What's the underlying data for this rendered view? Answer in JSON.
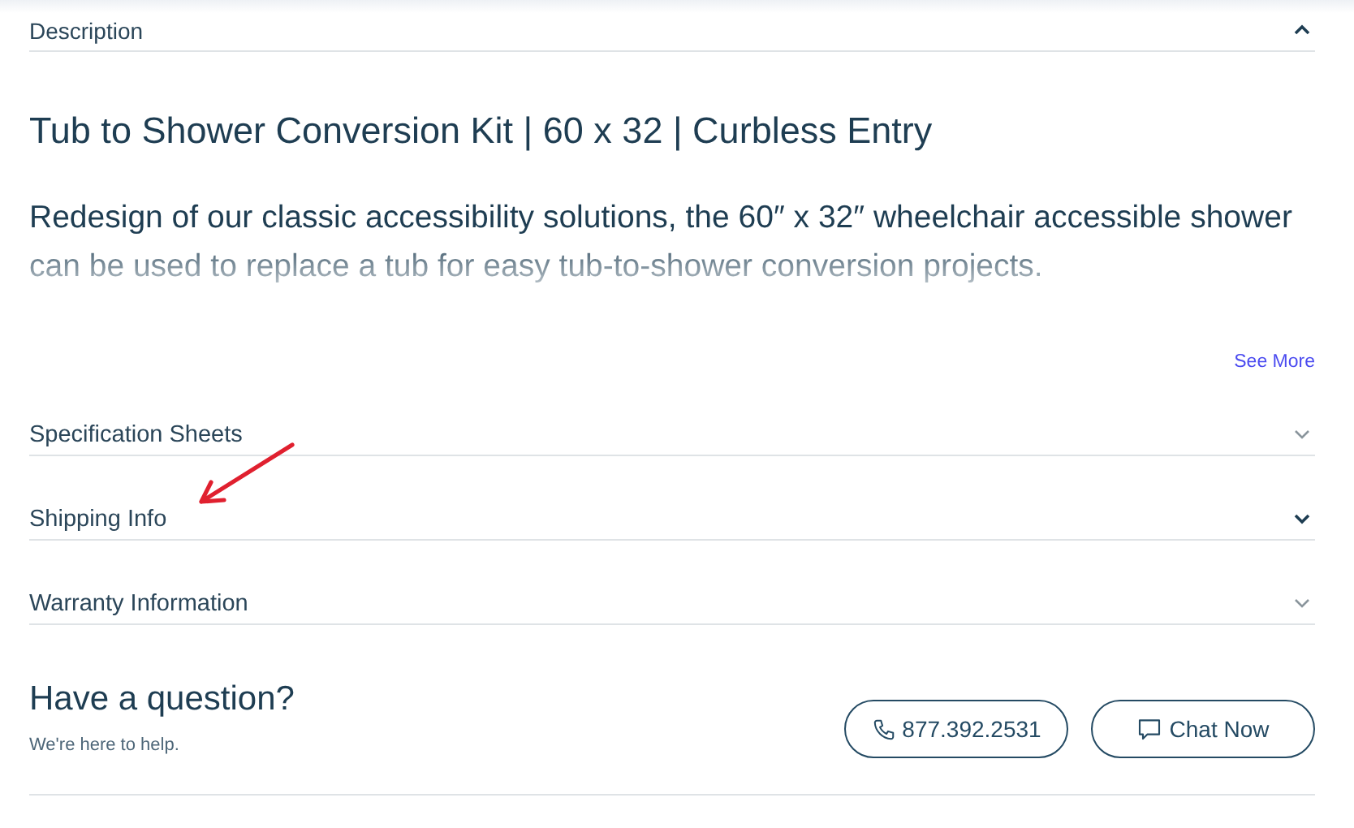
{
  "description": {
    "label": "Description",
    "expanded": true,
    "title": "Tub to Shower Conversion Kit | 60 x 32 | Curbless Entry",
    "text": "Redesign of our classic accessibility solutions, the 60″ x 32″ wheelchair accessible shower can be used to replace a tub for easy tub-to-shower conversion projects.",
    "see_more": "See More"
  },
  "sections": [
    {
      "label": "Specification Sheets",
      "expanded": false,
      "highlighted": false
    },
    {
      "label": "Shipping Info",
      "expanded": false,
      "highlighted": true
    },
    {
      "label": "Warranty Information",
      "expanded": false,
      "highlighted": false
    }
  ],
  "contact": {
    "title": "Have a question?",
    "subtitle": "We're here to help.",
    "phone": "877.392.2531",
    "chat": "Chat Now"
  }
}
